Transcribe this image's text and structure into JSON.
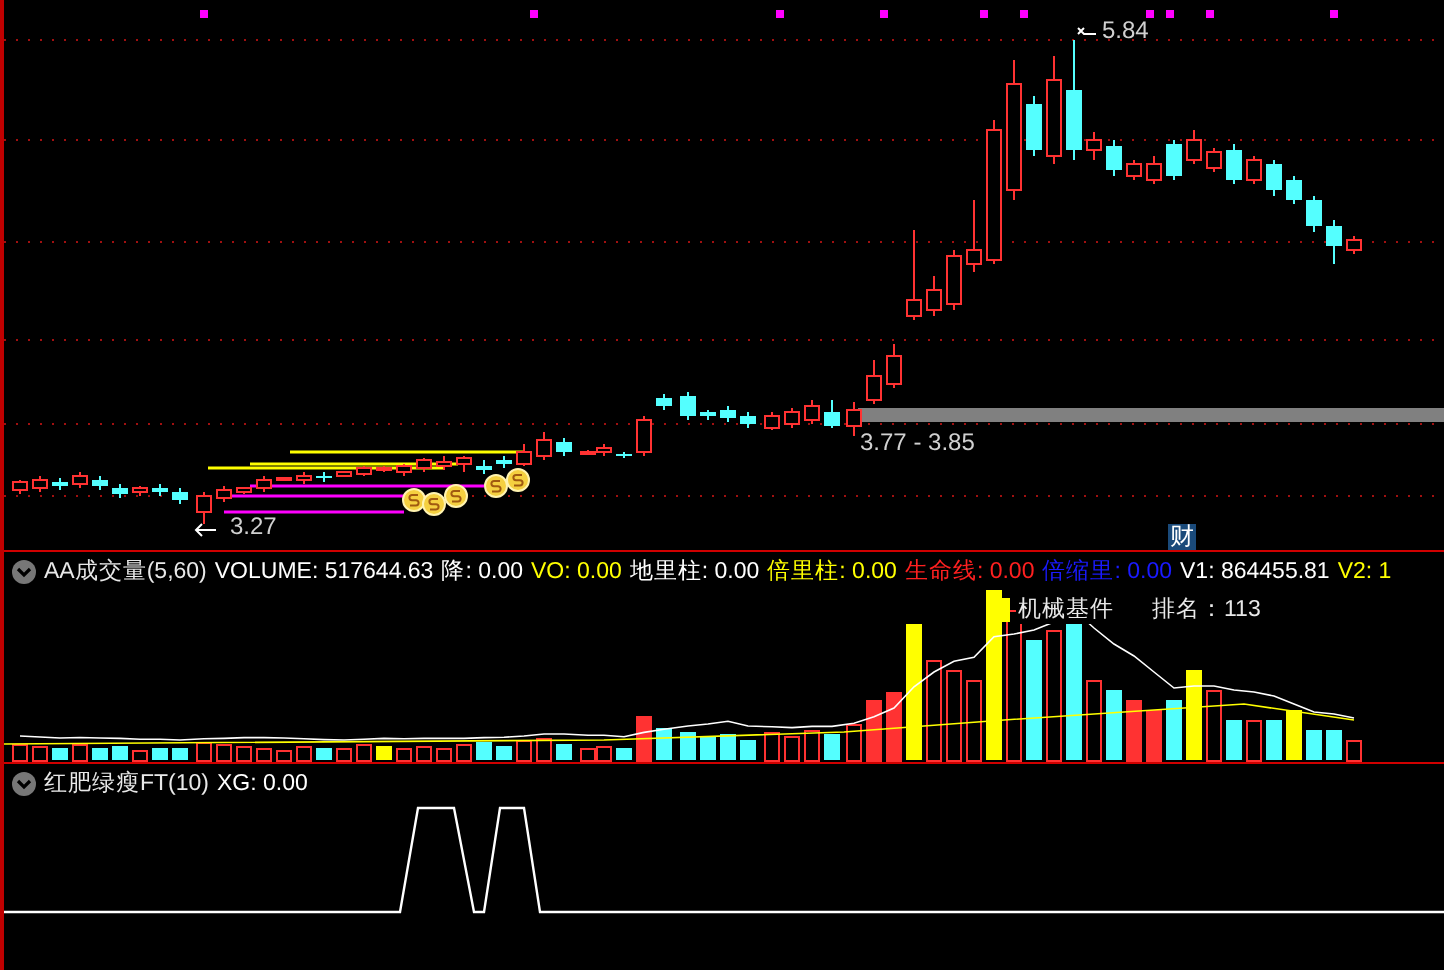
{
  "price_pane": {
    "high_label": "5.84",
    "low_label": "3.27",
    "zone_label": "3.77 - 3.85",
    "badge": "财"
  },
  "volume_pane": {
    "title": "AA成交量(5,60)",
    "items": [
      {
        "text": "VOLUME: 517644.63",
        "color": "#ffffff"
      },
      {
        "text": "降: 0.00",
        "color": "#ffffff"
      },
      {
        "text": "VO: 0.00",
        "color": "#ffff00"
      },
      {
        "text": "地里柱: 0.00",
        "color": "#ffffff"
      },
      {
        "text": "倍里柱: 0.00",
        "color": "#ffff00"
      },
      {
        "text": "生命线: 0.00",
        "color": "#ff2020"
      },
      {
        "text": "倍缩里: 0.00",
        "color": "#1a1aff"
      },
      {
        "text": "V1: 864455.81",
        "color": "#ffffff"
      },
      {
        "text": "V2: 1",
        "color": "#ffff00"
      }
    ],
    "legend": {
      "label": "机械基件",
      "color": "#ffff00"
    },
    "rank": "排名：113"
  },
  "signal_pane": {
    "title": "红肥绿瘦FT(10)",
    "items": [
      {
        "text": "XG: 0.00",
        "color": "#ffffff"
      }
    ]
  }
}
